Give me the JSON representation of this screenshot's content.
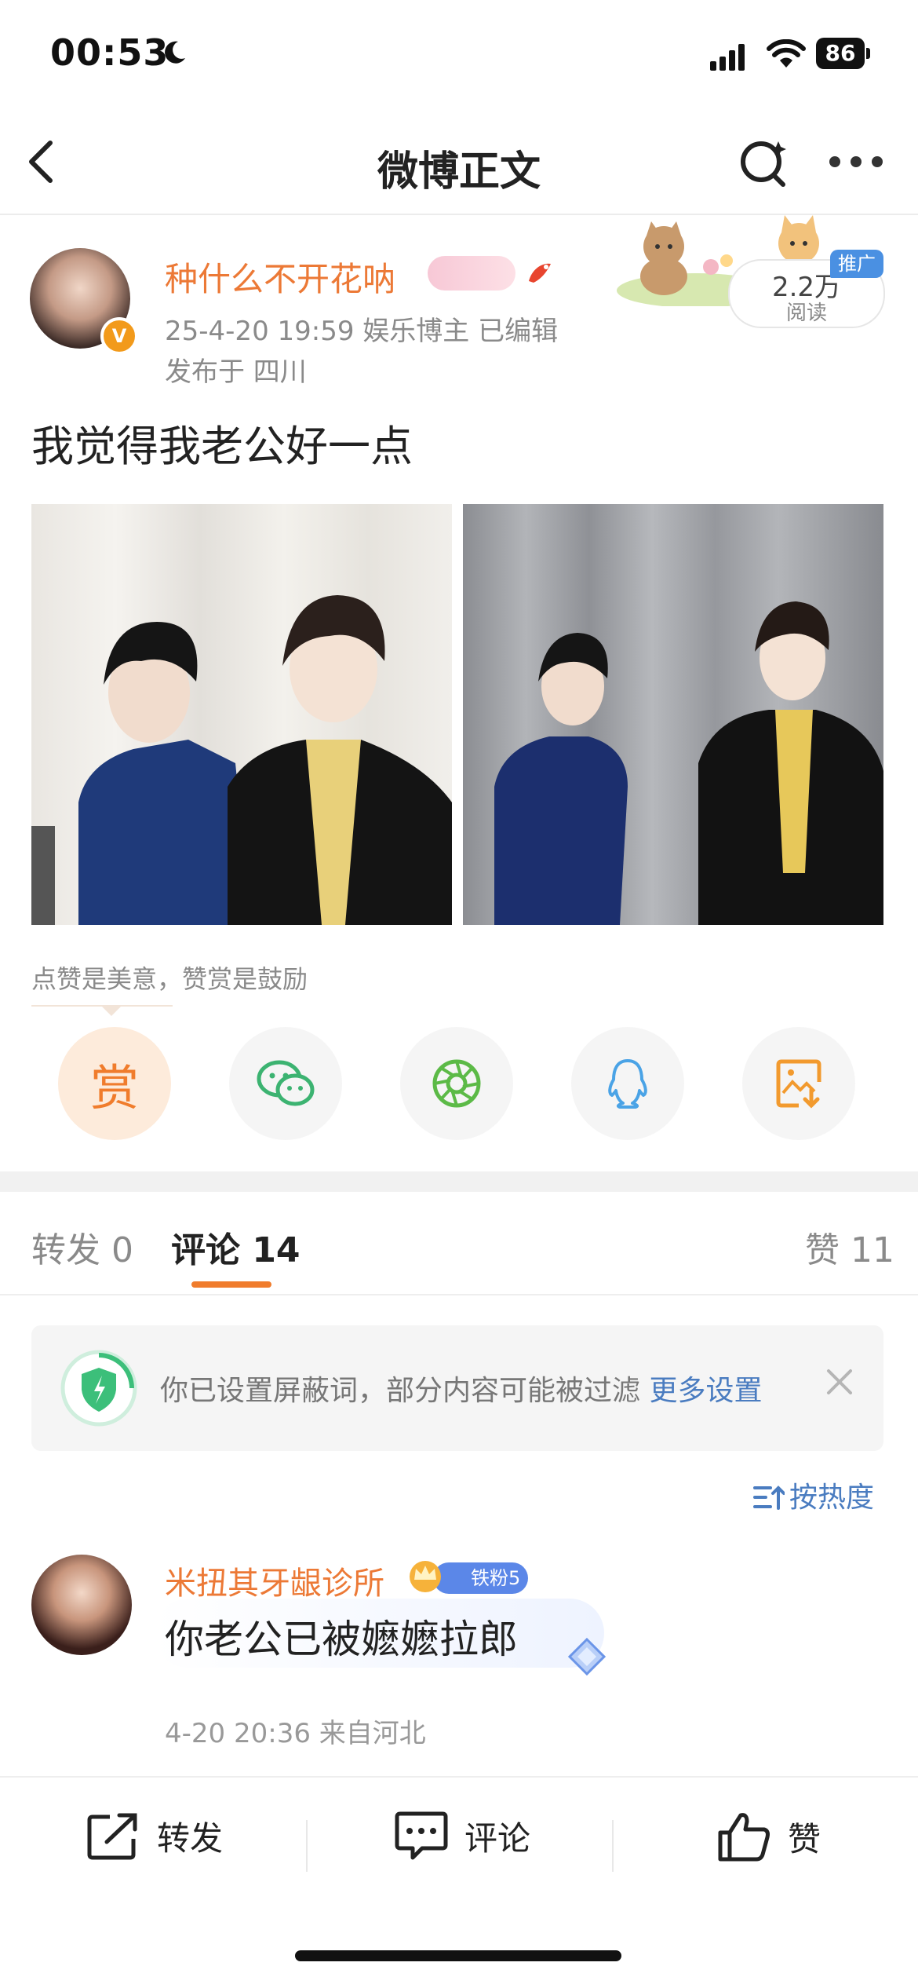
{
  "status_bar": {
    "time": "00:53",
    "battery": "86"
  },
  "nav": {
    "title": "微博正文"
  },
  "author": {
    "name": "种什么不开花呐",
    "meta": "25-4-20 19:59  娱乐博主  已编辑",
    "location": "发布于 四川",
    "verified_badge": "V"
  },
  "read_stats": {
    "count": "2.2万",
    "label": "阅读",
    "promo": "推广"
  },
  "post": {
    "text": "我觉得我老公好一点"
  },
  "reward": {
    "hint": "点赞是美意，赞赏是鼓励",
    "button_label": "赏",
    "share_icons": [
      "reward-icon",
      "wechat-icon",
      "moments-icon",
      "qq-icon",
      "save-image-icon"
    ]
  },
  "tabs": [
    {
      "label": "转发 0"
    },
    {
      "label": "评论 14"
    },
    {
      "label": "赞 11"
    }
  ],
  "notice": {
    "text": "你已设置屏蔽词，部分内容可能被过滤",
    "link": "更多设置"
  },
  "sort": {
    "label": "按热度"
  },
  "comment": {
    "user": "米扭其牙龈诊所",
    "badge": "铁粉5",
    "text": "你老公已被嬷嬷拉郎",
    "meta": "4-20 20:36 来自河北"
  },
  "bottom_bar": {
    "repost": "转发",
    "comment": "评论",
    "like": "赞"
  },
  "colors": {
    "accent_orange": "#f07c2c",
    "name_orange": "#ec7936",
    "link_blue": "#4a7cc0"
  }
}
